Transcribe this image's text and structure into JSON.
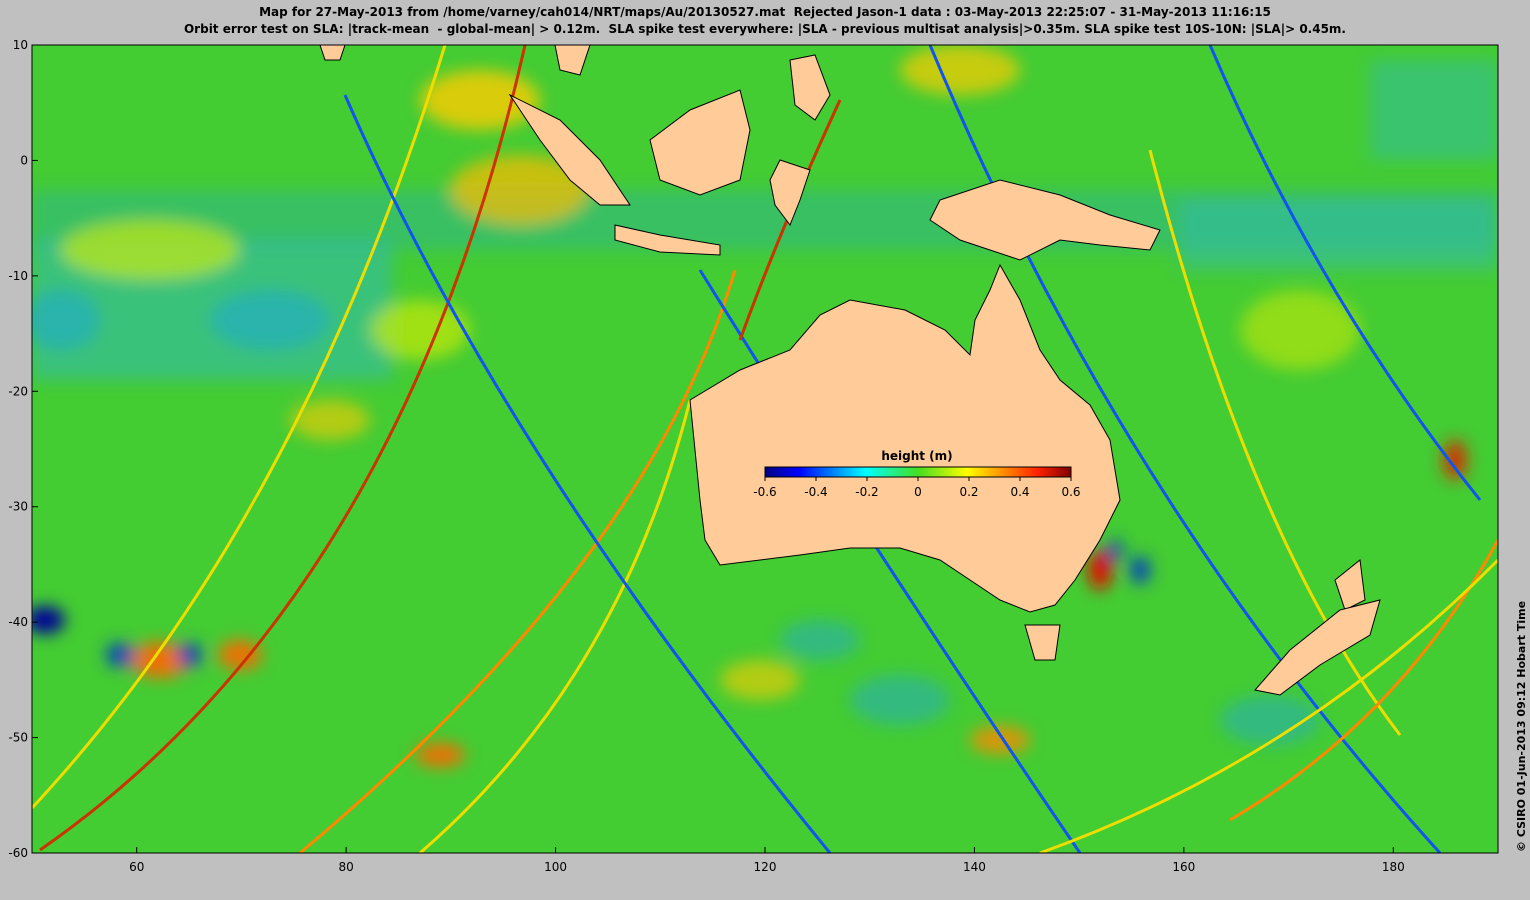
{
  "title": {
    "line1": "Map for 27-May-2013 from /home/varney/cah014/NRT/maps/Au/20130527.mat  Rejected Jason-1 data : 03-May-2013 22:25:07 - 31-May-2013 11:16:15",
    "line2": "Orbit error test on SLA: |track-mean  - global-mean| > 0.12m.  SLA spike test everywhere: |SLA - previous multisat analysis|>0.35m. SLA spike test 10S-10N: |SLA|> 0.45m."
  },
  "credit": "© CSIRO 01-Jun-2013 09:12 Hobart Time",
  "map": {
    "lon_range": [
      50,
      190
    ],
    "lat_range": [
      -60,
      10
    ],
    "x_ticks": [
      "60",
      "80",
      "100",
      "120",
      "140",
      "160",
      "180"
    ],
    "y_ticks": [
      "10",
      "0",
      "-10",
      "-20",
      "-30",
      "-40",
      "-50",
      "-60"
    ],
    "land_color": "#ffcc99",
    "ocean_base_color": "#44cc33"
  },
  "colorbar": {
    "title": "height (m)",
    "ticks": [
      "-0.6",
      "-0.4",
      "-0.2",
      "0",
      "0.2",
      "0.4",
      "0.6"
    ],
    "colors": [
      "#00007f",
      "#0000ff",
      "#0080ff",
      "#00ffff",
      "#00ff80",
      "#80ff00",
      "#ffff00",
      "#ff8000",
      "#ff0000",
      "#7f0000"
    ]
  }
}
